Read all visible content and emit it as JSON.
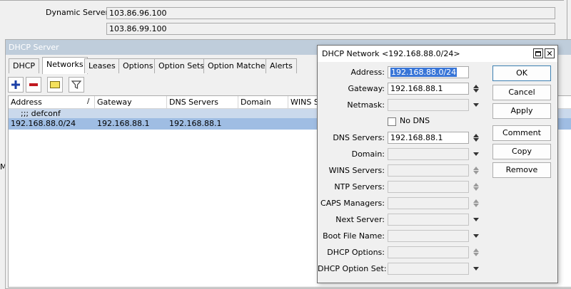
{
  "background": {
    "dynamic_servers_label": "Dynamic Servers:",
    "dynamic_servers": [
      "103.86.96.100",
      "103.86.99.100"
    ]
  },
  "dhcp_window": {
    "title": "DHCP Server",
    "tabs": [
      "DHCP",
      "Networks",
      "Leases",
      "Options",
      "Option Sets",
      "Option Matcher",
      "Alerts"
    ],
    "active_tab": "Networks",
    "toolbar": {
      "icons": [
        "plus-icon",
        "minus-icon",
        "comment-icon",
        "filter-icon"
      ]
    },
    "columns": [
      "Address",
      "Gateway",
      "DNS Servers",
      "Domain",
      "WINS Se"
    ],
    "comment_row": ";;; defconf",
    "rows": [
      {
        "address": "192.168.88.0/24",
        "gateway": "192.168.88.1",
        "dns": "192.168.88.1",
        "domain": "",
        "wins": ""
      }
    ]
  },
  "dialog": {
    "title": "DHCP Network <192.168.88.0/24>",
    "fields": {
      "address": {
        "label": "Address:",
        "value": "192.168.88.0/24"
      },
      "gateway": {
        "label": "Gateway:",
        "value": "192.168.88.1"
      },
      "netmask": {
        "label": "Netmask:",
        "value": ""
      },
      "no_dns": {
        "label": "No DNS",
        "checked": false
      },
      "dns_servers": {
        "label": "DNS Servers:",
        "value": "192.168.88.1"
      },
      "domain": {
        "label": "Domain:",
        "value": ""
      },
      "wins_servers": {
        "label": "WINS Servers:",
        "value": ""
      },
      "ntp_servers": {
        "label": "NTP Servers:",
        "value": ""
      },
      "caps_managers": {
        "label": "CAPS Managers:",
        "value": ""
      },
      "next_server": {
        "label": "Next Server:",
        "value": ""
      },
      "boot_file_name": {
        "label": "Boot File Name:",
        "value": ""
      },
      "dhcp_options": {
        "label": "DHCP Options:",
        "value": ""
      },
      "dhcp_option_set": {
        "label": "DHCP Option Set:",
        "value": ""
      }
    },
    "buttons": {
      "ok": "OK",
      "cancel": "Cancel",
      "apply": "Apply",
      "comment": "Comment",
      "copy": "Copy",
      "remove": "Remove"
    }
  },
  "colors": {
    "selected_row": "#9fbde3",
    "comment_row": "#cad9ec",
    "title_inactive": "#bfcddb",
    "selection": "#3875d7"
  }
}
